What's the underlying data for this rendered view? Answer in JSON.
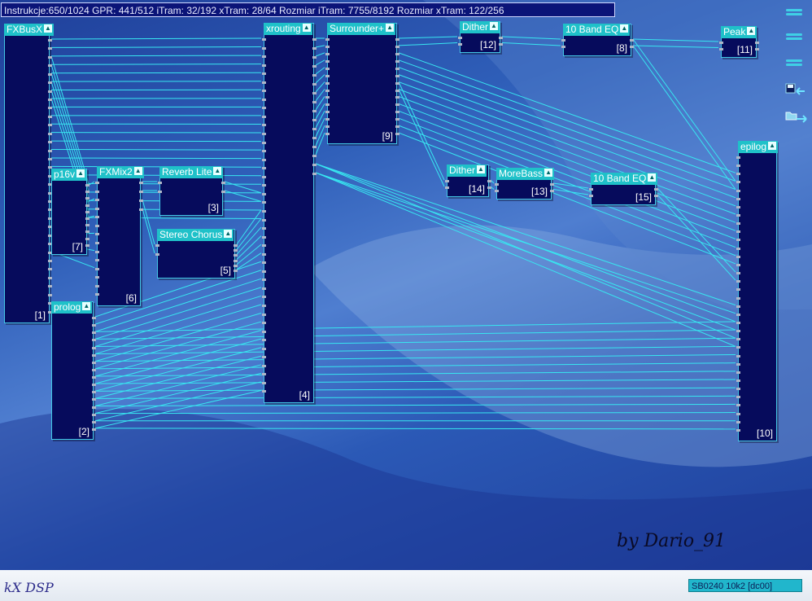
{
  "status": {
    "text": "Instrukcje:650/1024 GPR: 441/512 iTram: 32/192 xTram: 28/64 Rozmiar iTram: 7755/8192 Rozmiar xTram: 122/256"
  },
  "plugins": {
    "fxbusx": {
      "title": "FXBusX",
      "index": "[1]"
    },
    "p16v": {
      "title": "p16v",
      "index": "[7]"
    },
    "fxmix2": {
      "title": "FXMix2",
      "index": "[6]"
    },
    "reverb": {
      "title": "Reverb Lite",
      "index": "[3]"
    },
    "chorus": {
      "title": "Stereo Chorus",
      "index": "[5]"
    },
    "prolog": {
      "title": "prolog",
      "index": "[2]"
    },
    "xrouting": {
      "title": "xrouting",
      "index": "[4]"
    },
    "surrounder": {
      "title": "Surrounder+",
      "index": "[9]"
    },
    "dither1": {
      "title": "Dither",
      "index": "[12]"
    },
    "eq1": {
      "title": "10 Band EQ",
      "index": "[8]"
    },
    "peak": {
      "title": "Peak",
      "index": "[11]"
    },
    "epilog": {
      "title": "epilog",
      "index": "[10]"
    },
    "dither2": {
      "title": "Dither",
      "index": "[14]"
    },
    "morebass": {
      "title": "MoreBass",
      "index": "[13]"
    },
    "eq2": {
      "title": "10 Band EQ",
      "index": "[15]"
    }
  },
  "footer": {
    "logo": "kX DSP",
    "signature": "by Dario_91",
    "card": "SB0240 10k2 [dc00]"
  },
  "icons": {
    "side_buttons": [
      "menu-lines-icon",
      "menu-lines-icon",
      "menu-lines-icon"
    ],
    "save": "save-icon",
    "open": "folder-open-icon"
  },
  "colors": {
    "wire": "#38e6f0",
    "plugin_body": "#060b5c",
    "title_bar": "#1fc1c9"
  }
}
